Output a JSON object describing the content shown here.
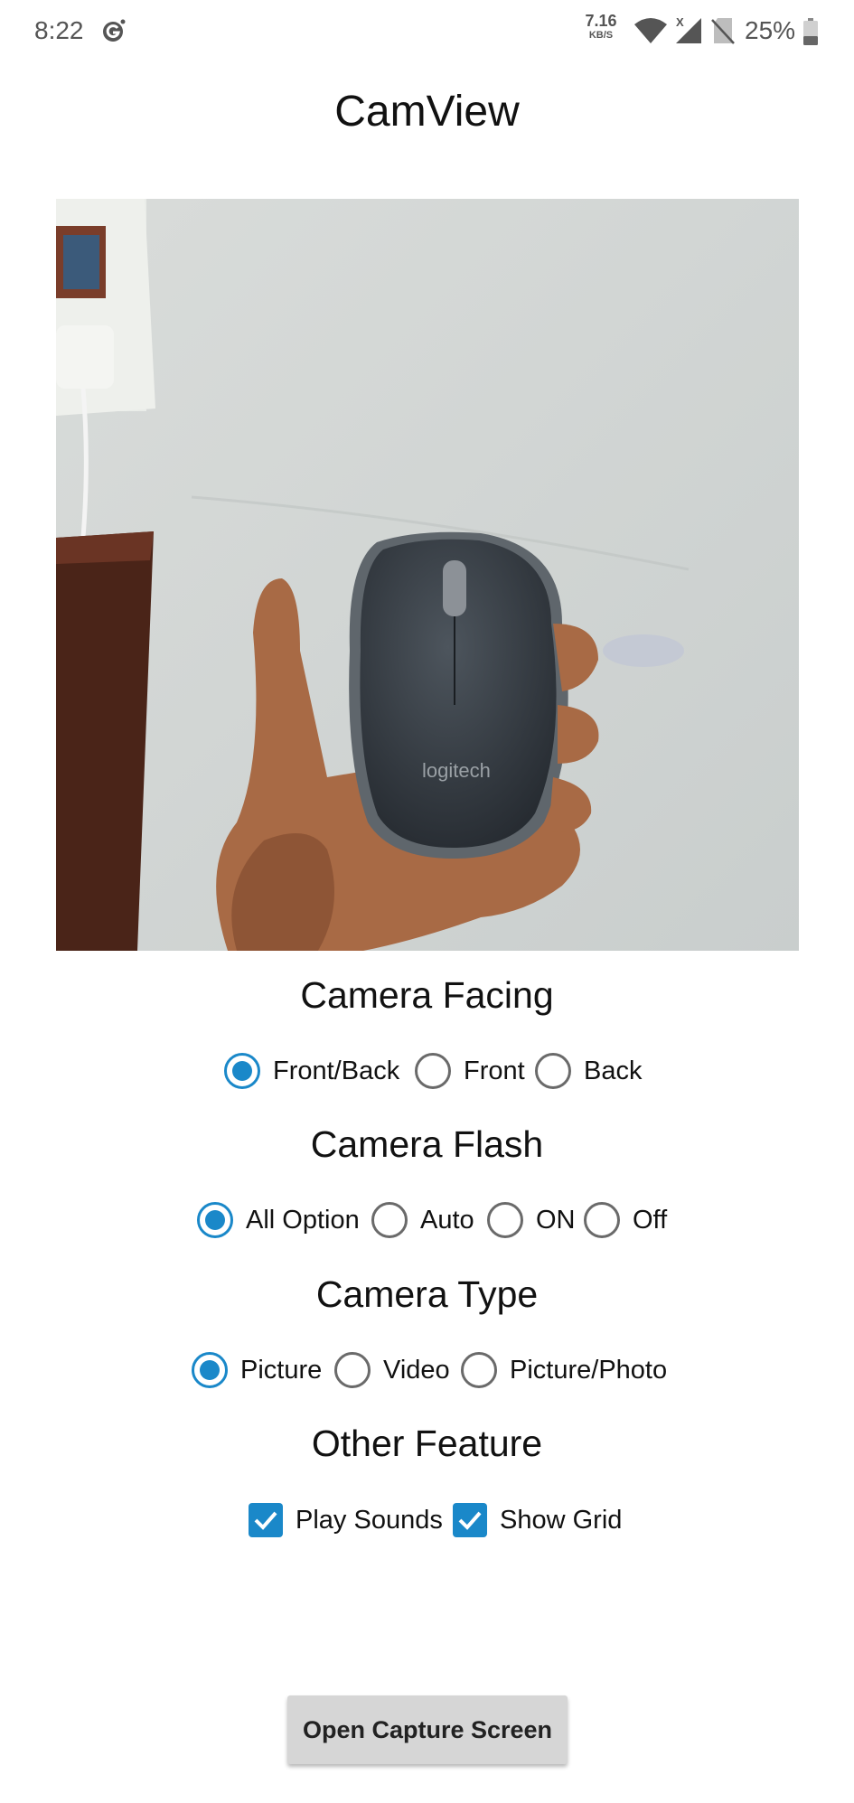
{
  "status_bar": {
    "time": "8:22",
    "net_speed_value": "7.16",
    "net_speed_unit": "KB/S",
    "signal_badge": "X",
    "battery_percent": "25%",
    "icons": [
      "g-app-icon",
      "wifi-icon",
      "signal-icon",
      "no-sim-icon",
      "battery-icon"
    ]
  },
  "app": {
    "title": "CamView"
  },
  "preview": {
    "brand_text": "logitech"
  },
  "camera_facing": {
    "title": "Camera Facing",
    "options": [
      {
        "label": "Front/Back",
        "checked": true
      },
      {
        "label": "Front",
        "checked": false
      },
      {
        "label": "Back",
        "checked": false
      }
    ]
  },
  "camera_flash": {
    "title": "Camera Flash",
    "options": [
      {
        "label": "All Option",
        "checked": true
      },
      {
        "label": "Auto",
        "checked": false
      },
      {
        "label": "ON",
        "checked": false
      },
      {
        "label": "Off",
        "checked": false
      }
    ]
  },
  "camera_type": {
    "title": "Camera Type",
    "options": [
      {
        "label": "Picture",
        "checked": true
      },
      {
        "label": "Video",
        "checked": false
      },
      {
        "label": "Picture/Photo",
        "checked": false
      }
    ]
  },
  "other_feature": {
    "title": "Other Feature",
    "options": [
      {
        "label": "Play Sounds",
        "checked": true
      },
      {
        "label": "Show Grid",
        "checked": true
      }
    ]
  },
  "capture_button": {
    "label": "Open Capture Screen"
  },
  "colors": {
    "accent": "#1a88c9",
    "button_bg": "#d6d6d6",
    "radio_off": "#6a6a6a"
  }
}
